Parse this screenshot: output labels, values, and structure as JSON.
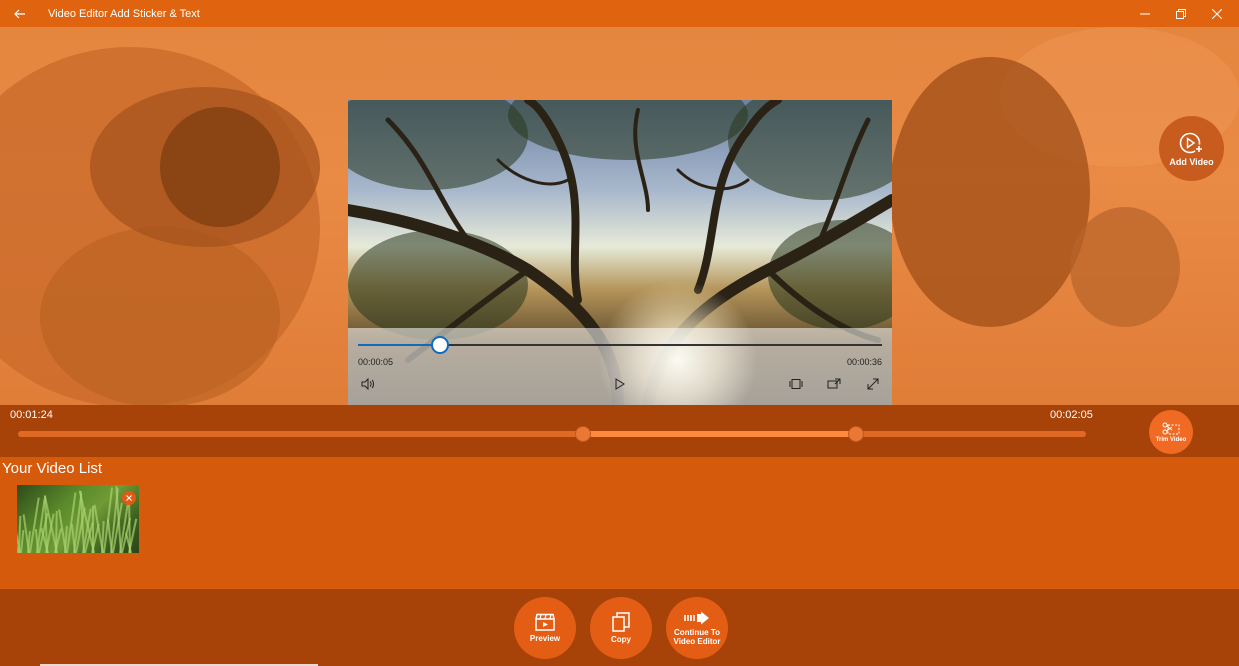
{
  "window": {
    "title": "Video Editor Add Sticker & Text"
  },
  "player": {
    "current_time": "00:00:05",
    "duration": "00:00:36",
    "progress_fraction": 0.156
  },
  "hero": {
    "add_video_label": "Add Video"
  },
  "trim": {
    "start_time": "00:01:24",
    "end_time": "00:02:05",
    "start_fraction": 0.529,
    "end_fraction": 0.785,
    "button_label": "Trim Video"
  },
  "video_list": {
    "title": "Your Video List",
    "items": [
      {
        "thumbnail": "grass-clip"
      }
    ]
  },
  "actions": {
    "preview_label": "Preview",
    "copy_label": "Copy",
    "continue_label": "Continue To Video Editor"
  },
  "colors": {
    "accent": "#e06410",
    "panel": "#a74308",
    "background": "#d65a0c",
    "button": "#e35e14",
    "seek": "#0f6cbd"
  }
}
